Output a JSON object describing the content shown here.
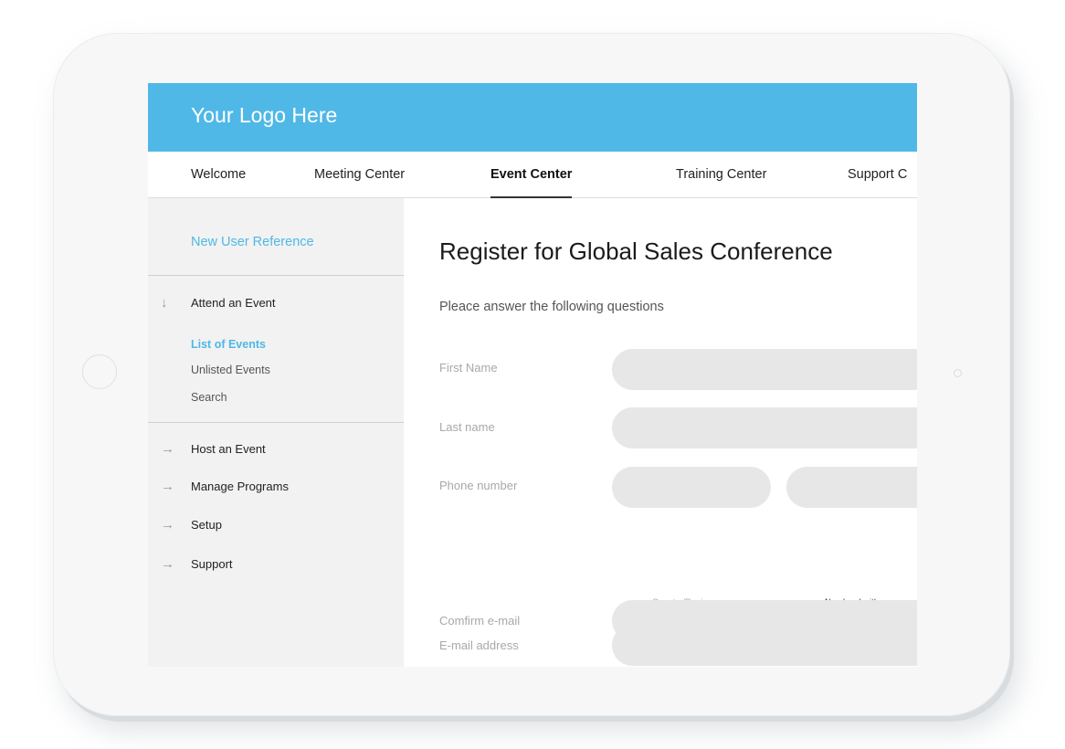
{
  "header": {
    "logo_text": "Your Logo Here",
    "brand_color": "#4fb8e6"
  },
  "tabs": [
    {
      "label": "Welcome",
      "active": false
    },
    {
      "label": "Meeting Center",
      "active": false
    },
    {
      "label": "Event Center",
      "active": true
    },
    {
      "label": "Training Center",
      "active": false
    },
    {
      "label": "Support C",
      "active": false
    }
  ],
  "sidebar": {
    "reference_link": "New User Reference",
    "sections": [
      {
        "label": "Attend an Event",
        "icon": "arrow-down-icon",
        "expanded": true,
        "items": [
          {
            "label": "List of Events",
            "active": true
          },
          {
            "label": "Unlisted Events",
            "active": false
          },
          {
            "label": "Search",
            "active": false
          }
        ]
      },
      {
        "label": "Host an Event",
        "icon": "arrow-right-icon",
        "expanded": false
      },
      {
        "label": "Manage Programs",
        "icon": "arrow-right-icon",
        "expanded": false
      },
      {
        "label": "Setup",
        "icon": "arrow-right-icon",
        "expanded": false
      },
      {
        "label": "Support",
        "icon": "arrow-right-icon",
        "expanded": false
      }
    ]
  },
  "main": {
    "title": "Register for Global Sales Conference",
    "subtitle": "Pleace answer the following questions",
    "fields": {
      "first_name": {
        "label": "First Name",
        "value": ""
      },
      "last_name": {
        "label": "Last name",
        "value": ""
      },
      "phone": {
        "label": "Phone number",
        "country_value": "",
        "number_value": "",
        "country_hint": "Country/Region",
        "number_hint": "Number ( with are"
      },
      "email": {
        "label": "E-mail address",
        "value": ""
      },
      "confirm_email": {
        "label": "Comfirm e-mail",
        "value": ""
      }
    }
  }
}
